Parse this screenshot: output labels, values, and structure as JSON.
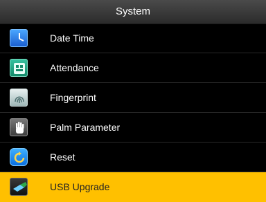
{
  "header": {
    "title": "System"
  },
  "menu": {
    "items": [
      {
        "label": "Date Time",
        "icon": "clock-icon",
        "selected": false
      },
      {
        "label": "Attendance",
        "icon": "attendance-icon",
        "selected": false
      },
      {
        "label": "Fingerprint",
        "icon": "fingerprint-icon",
        "selected": false
      },
      {
        "label": "Palm Parameter",
        "icon": "palm-icon",
        "selected": false
      },
      {
        "label": "Reset",
        "icon": "reset-icon",
        "selected": false
      },
      {
        "label": "USB Upgrade",
        "icon": "usb-icon",
        "selected": true
      }
    ]
  },
  "colors": {
    "header_bg": "#3a3a3a",
    "background": "#000000",
    "selected_bg": "#ffc000"
  }
}
